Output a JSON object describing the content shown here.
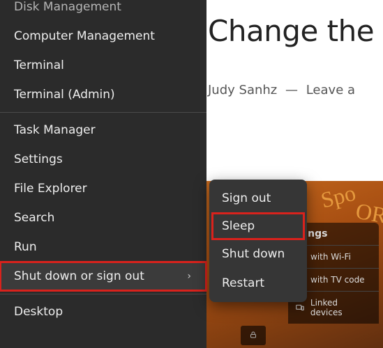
{
  "background_article": {
    "title_fragment": "Change the",
    "author": "Judy Sanhz",
    "byline_sep": "—",
    "byline_suffix": "Leave a"
  },
  "youtube_panel": {
    "header": "ttings",
    "items": [
      {
        "label": "with Wi-Fi"
      },
      {
        "label": "with TV code"
      },
      {
        "label": "Linked devices"
      }
    ]
  },
  "power_menu": {
    "items": [
      {
        "key": "disk-management",
        "label": "Disk Management",
        "cutoff": true
      },
      {
        "key": "computer-management",
        "label": "Computer Management"
      },
      {
        "key": "terminal",
        "label": "Terminal"
      },
      {
        "key": "terminal-admin",
        "label": "Terminal (Admin)"
      }
    ],
    "items2": [
      {
        "key": "task-manager",
        "label": "Task Manager"
      },
      {
        "key": "settings",
        "label": "Settings"
      },
      {
        "key": "file-explorer",
        "label": "File Explorer"
      },
      {
        "key": "search",
        "label": "Search"
      },
      {
        "key": "run",
        "label": "Run"
      },
      {
        "key": "shutdown-signout",
        "label": "Shut down or sign out",
        "has_sub": true,
        "highlighted": true,
        "hover": true
      }
    ],
    "items3": [
      {
        "key": "desktop",
        "label": "Desktop"
      }
    ],
    "chevron_glyph": "›"
  },
  "shutdown_submenu": {
    "items": [
      {
        "key": "sign-out",
        "label": "Sign out"
      },
      {
        "key": "sleep",
        "label": "Sleep",
        "highlighted": true
      },
      {
        "key": "shut-down",
        "label": "Shut down"
      },
      {
        "key": "restart",
        "label": "Restart"
      }
    ]
  },
  "highlight_color": "#d9221c"
}
